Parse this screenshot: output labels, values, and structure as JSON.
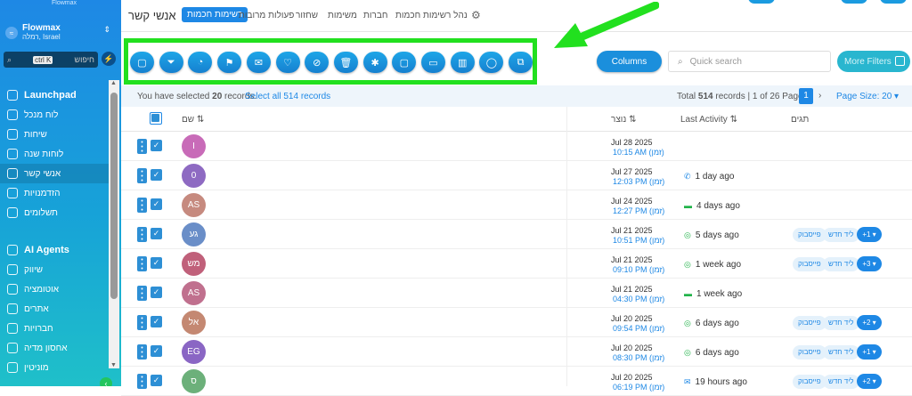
{
  "sidebar": {
    "logo": "Flowmax",
    "workspace": {
      "name": "Flowmax",
      "sub": "רמלה, Israel",
      "avatar": "≈"
    },
    "search": {
      "placeholder": "חיפוש",
      "shortcut": "ctrl K"
    },
    "items": [
      {
        "label": "Launchpad",
        "big": true
      },
      {
        "label": "לוח מנכל"
      },
      {
        "label": "שיחות"
      },
      {
        "label": "לוחות שנה"
      },
      {
        "label": "אנשי קשר",
        "active": true
      },
      {
        "label": "הזדמנויות"
      },
      {
        "label": "תשלומים"
      },
      {
        "label": "AI Agents",
        "big": true
      },
      {
        "label": "שיווק"
      },
      {
        "label": "אוטומציה"
      },
      {
        "label": "אתרים"
      },
      {
        "label": "חברויות"
      },
      {
        "label": "אחסון מדיה"
      },
      {
        "label": "מוניטין"
      }
    ]
  },
  "header": {
    "title": "אנשי קשר",
    "tabs": [
      "רשימות חכמות",
      "פעולות מרובות",
      "שחזור",
      "משימות",
      "חברות",
      "נהל רשימות חכמות"
    ]
  },
  "toolbar": {
    "icons": [
      "square-icon",
      "filter-icon",
      "pie-icon",
      "flag-icon",
      "mail-icon",
      "tag-add-icon",
      "tag-remove-icon",
      "trash-icon",
      "star-icon",
      "square-icon",
      "message-icon",
      "building-icon",
      "whatsapp-icon",
      "copy-icon"
    ],
    "columns_label": "Columns",
    "search_placeholder": "Quick search",
    "more_filters_label": "More Filters"
  },
  "selection": {
    "prefix": "You have selected ",
    "count": "20",
    "suffix": " records.",
    "select_all": "Select all 514 records",
    "total_prefix": "Total ",
    "total": "514",
    "total_suffix": " records | 1 of 26 Pages",
    "page": "1",
    "page_size": "Page Size: 20"
  },
  "columns": {
    "name": "שם",
    "created": "נוצר",
    "last_activity": "Last Activity",
    "tags": "תגים"
  },
  "rows": [
    {
      "initials": "I",
      "color": "#c86bb8",
      "date": "Jul 28 2025",
      "time": "10:15 AM (זמן)",
      "activity": "",
      "icon": "",
      "tags": [],
      "plus": ""
    },
    {
      "initials": "0",
      "color": "#8e6ac2",
      "date": "Jul 27 2025",
      "time": "12:03 PM (זמן)",
      "activity": "1 day ago",
      "icon": "phone",
      "tags": [],
      "plus": ""
    },
    {
      "initials": "AS",
      "color": "#c68a7f",
      "date": "Jul 24 2025",
      "time": "12:27 PM (זמן)",
      "activity": "4 days ago",
      "icon": "sms",
      "tags": [],
      "plus": ""
    },
    {
      "initials": "גע",
      "color": "#6a8ec8",
      "date": "Jul 21 2025",
      "time": "10:51 PM (זמן)",
      "activity": "5 days ago",
      "icon": "wa",
      "tags": [
        "פייסבוק",
        "ליד חדש"
      ],
      "plus": "+1"
    },
    {
      "initials": "מש",
      "color": "#c0607a",
      "date": "Jul 21 2025",
      "time": "09:10 PM (זמן)",
      "activity": "1 week ago",
      "icon": "wa",
      "tags": [
        "פייסבוק",
        "ליד חדש"
      ],
      "plus": "+3"
    },
    {
      "initials": "AS",
      "color": "#c0708e",
      "date": "Jul 21 2025",
      "time": "04:30 PM (זמן)",
      "activity": "1 week ago",
      "icon": "sms",
      "tags": [],
      "plus": ""
    },
    {
      "initials": "אל",
      "color": "#c48872",
      "date": "Jul 20 2025",
      "time": "09:54 PM (זמן)",
      "activity": "6 days ago",
      "icon": "wa",
      "tags": [
        "פייסבוק",
        "ליד חדש"
      ],
      "plus": "+2"
    },
    {
      "initials": "EG",
      "color": "#8a66c4",
      "date": "Jul 20 2025",
      "time": "08:30 PM (זמן)",
      "activity": "6 days ago",
      "icon": "wa",
      "tags": [
        "פייסבוק",
        "ליד חדש"
      ],
      "plus": "+1"
    },
    {
      "initials": "ס",
      "color": "#6cb07a",
      "date": "Jul 20 2025",
      "time": "06:19 PM (זמן)",
      "activity": "19 hours ago",
      "icon": "mail",
      "tags": [
        "פייסבוק",
        "ליד חדש"
      ],
      "plus": "+2"
    }
  ],
  "colors": {
    "accent": "#1e88e5",
    "highlight": "#22e01f"
  }
}
